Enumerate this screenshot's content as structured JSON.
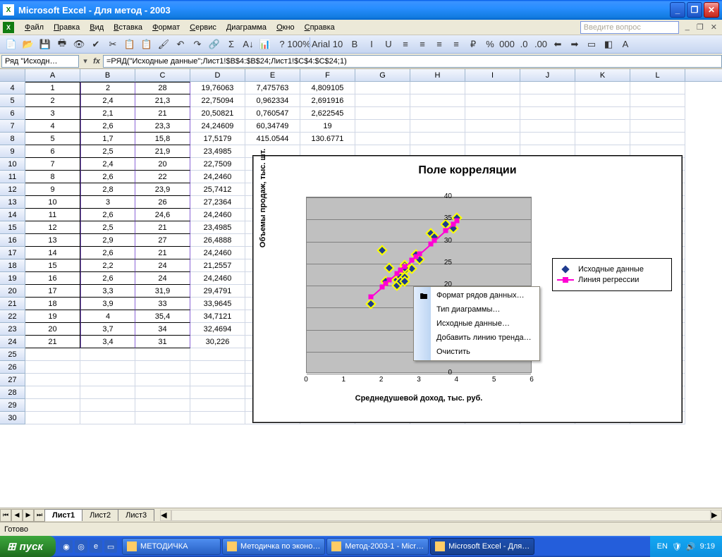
{
  "title": "Microsoft Excel - Для метод - 2003",
  "window": {
    "min": "_",
    "max": "❐",
    "close": "✕"
  },
  "menu": [
    "Файл",
    "Правка",
    "Вид",
    "Вставка",
    "Формат",
    "Сервис",
    "Диаграмма",
    "Окно",
    "Справка"
  ],
  "askbox": "Введите вопрос",
  "mdi": [
    "_",
    "❐",
    "✕"
  ],
  "namebox": "Ряд \"Исходн…",
  "formula": "=РЯД(\"Исходные данные\";Лист1!$B$4:$B$24;Лист1!$C$4:$C$24;1)",
  "columns": [
    "A",
    "B",
    "C",
    "D",
    "E",
    "F",
    "G",
    "H",
    "I",
    "J",
    "K",
    "L"
  ],
  "rowstart": 4,
  "rowcount": 27,
  "table": {
    "A": [
      "1",
      "2",
      "3",
      "4",
      "5",
      "6",
      "7",
      "8",
      "9",
      "10",
      "11",
      "12",
      "13",
      "14",
      "15",
      "16",
      "17",
      "18",
      "19",
      "20",
      "21"
    ],
    "B": [
      "2",
      "2,4",
      "2,1",
      "2,6",
      "1,7",
      "2,5",
      "2,4",
      "2,6",
      "2,8",
      "3",
      "2,6",
      "2,5",
      "2,9",
      "2,6",
      "2,2",
      "2,6",
      "3,3",
      "3,9",
      "4",
      "3,7",
      "3,4"
    ],
    "C": [
      "28",
      "21,3",
      "21",
      "23,3",
      "15,8",
      "21,9",
      "20",
      "22",
      "23,9",
      "26",
      "24,6",
      "21",
      "27",
      "21",
      "24",
      "24",
      "31,9",
      "33",
      "35,4",
      "34",
      "31"
    ],
    "D": [
      "19,76063",
      "22,75094",
      "20,50821",
      "24,24609",
      "17,5179",
      "23,4985",
      "22,7509",
      "24,2460",
      "25,7412",
      "27,2364",
      "24,2460",
      "23,4985",
      "26,4888",
      "24,2460",
      "21,2557",
      "24,2460",
      "29,4791",
      "33,9645",
      "34,7121",
      "32,4694",
      "30,226"
    ],
    "E": [
      "7,475763",
      "0,962334",
      "0,760547",
      "60,34749",
      "415.0544",
      "",
      "",
      "",
      "",
      "",
      "",
      "",
      "",
      "",
      "",
      "",
      "",
      "",
      "",
      "",
      ""
    ],
    "F": [
      "4,809105",
      "2,691916",
      "2,622545",
      "19",
      "130.6771",
      "",
      "",
      "",
      "",
      "",
      "",
      "",
      "",
      "",
      "",
      "",
      "",
      "",
      "",
      "",
      ""
    ]
  },
  "chart_data": {
    "type": "scatter",
    "title": "Поле корреляции",
    "xlabel": "Среднедушевой доход, тыс. руб.",
    "ylabel": "Объемы продаж, тыс. шт.",
    "xlim": [
      0,
      6
    ],
    "ylim": [
      0,
      40
    ],
    "xticks": [
      0,
      1,
      2,
      3,
      4,
      5,
      6
    ],
    "yticks": [
      0,
      5,
      10,
      15,
      20,
      25,
      30,
      35,
      40
    ],
    "series": [
      {
        "name": "Исходные данные",
        "kind": "points",
        "x": [
          2,
          2.4,
          2.1,
          2.6,
          1.7,
          2.5,
          2.4,
          2.6,
          2.8,
          3,
          2.6,
          2.5,
          2.9,
          2.6,
          2.2,
          2.6,
          3.3,
          3.9,
          4,
          3.7,
          3.4
        ],
        "y": [
          28,
          21.3,
          21,
          23.3,
          15.8,
          21.9,
          20,
          22,
          23.9,
          26,
          24.6,
          21,
          27,
          21,
          24,
          24,
          31.9,
          33,
          35.4,
          34,
          31
        ]
      },
      {
        "name": "Линия регрессии",
        "kind": "line",
        "x": [
          1.7,
          2,
          2.1,
          2.2,
          2.4,
          2.5,
          2.6,
          2.8,
          2.9,
          3,
          3.3,
          3.4,
          3.7,
          3.9,
          4
        ],
        "y": [
          17.52,
          19.76,
          20.51,
          21.26,
          22.75,
          23.5,
          24.25,
          25.74,
          26.49,
          27.24,
          29.48,
          30.23,
          32.47,
          33.96,
          34.71
        ]
      }
    ]
  },
  "contextmenu": [
    "Формат рядов данных…",
    "Тип диаграммы…",
    "Исходные данные…",
    "Добавить линию тренда…",
    "Очистить"
  ],
  "sheets": {
    "active": "Лист1",
    "others": [
      "Лист2",
      "Лист3"
    ]
  },
  "status": "Готово",
  "taskbar": {
    "start": "пуск",
    "buttons": [
      "МЕТОДИЧКА",
      "Методичка по эконо…",
      "Метод-2003-1 - Micr…",
      "Microsoft Excel - Для…"
    ],
    "lang": "EN",
    "time": "9:19"
  },
  "toolbar_icons": [
    "📄",
    "📂",
    "💾",
    "🖶",
    "👁",
    "✔",
    "✂",
    "📋",
    "📋",
    "🖌",
    "↶",
    "↷",
    "🔗",
    "Σ",
    "A↓",
    "📊",
    "?",
    "100%"
  ],
  "format_icons": [
    "Arial",
    "10",
    "B",
    "I",
    "U",
    "≡",
    "≡",
    "≡",
    "≡",
    "₽",
    "%",
    "000",
    ".0",
    ".00",
    "⬅",
    "➡",
    "▭",
    "◧",
    "A"
  ]
}
